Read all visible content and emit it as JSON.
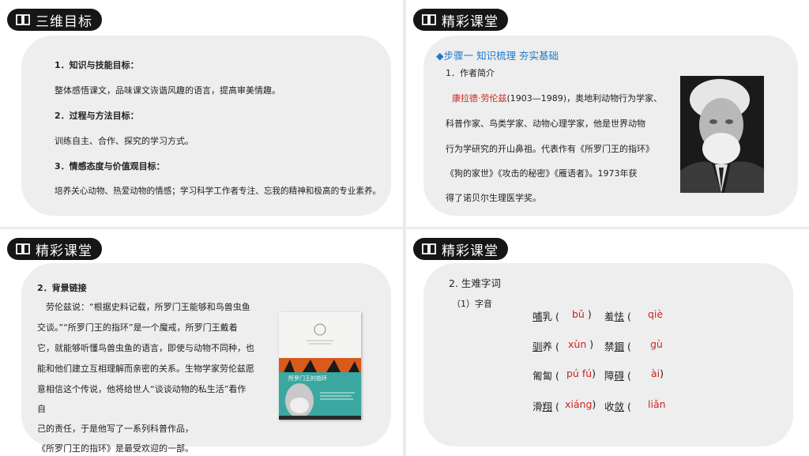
{
  "q1": {
    "header": "三维目标",
    "lines": [
      "1．知识与技能目标：",
      "整体感悟课文，品味课文诙谐风趣的语言，提高审美情趣。",
      "2．过程与方法目标：",
      "训练自主、合作、探究的学习方式。",
      "3．情感态度与价值观目标：",
      "培养关心动物、热爱动物的情感；学习科学工作者专注、忘我的精神和极高的专业素养。"
    ]
  },
  "q2": {
    "header": "精彩课堂",
    "step": "◆步骤一  知识梳理  夯实基础",
    "intro_title": "1．作者简介",
    "author_name": "康拉德·劳伦兹",
    "bio_first_rest": "(1903—1989)，奥地利动物行为学家、",
    "bio_lines": [
      "科普作家、鸟类学家、动物心理学家，他是世界动物",
      "行为学研究的开山鼻祖。代表作有《所罗门王的指环》",
      "《狗的家世》《攻击的秘密》《雁语者》。1973年获",
      "得了诺贝尔生理医学奖。"
    ]
  },
  "q3": {
    "header": "精彩课堂",
    "title": "2．背景链接",
    "lines": [
      "劳伦兹说：“根据史料记载，所罗门王能够和鸟兽虫鱼",
      "交谈。”“所罗门王的指环”是一个魔戒，所罗门王戴着",
      "它，就能够听懂鸟兽虫鱼的语言，即使与动物不同种，也",
      "能和他们建立互相理解而亲密的关系。生物学家劳伦兹愿",
      "意相信这个传说，他将给世人“谈谈动物的私生活”看作",
      "自",
      "己的责任，于是他写了一系列科普作品，",
      "《所罗门王的指环》是最受欢迎的一部。"
    ],
    "book_title": "所罗门王的指环"
  },
  "q4": {
    "header": "精彩课堂",
    "title": "2. 生难字词",
    "subtitle": "（1）字音",
    "words": [
      {
        "a": "哺",
        "b": "乳",
        "pinyin": "bǔ"
      },
      {
        "a": "羞",
        "b": "怯",
        "pinyin": "qiè"
      },
      {
        "a": "驯",
        "b": "养",
        "pinyin": "xùn"
      },
      {
        "a": "禁",
        "b": "錮",
        "pinyin": "gù"
      },
      {
        "a": "匍",
        "b": "匐",
        "pinyin": "pú fú"
      },
      {
        "a": "障",
        "b": "碍",
        "pinyin": "ài"
      },
      {
        "a": "滑",
        "b": "翔",
        "pinyin": "xiáng"
      },
      {
        "a": "收",
        "b": "敛",
        "pinyin": "liǎn"
      }
    ]
  },
  "colors": {
    "accent_blue": "#1f78c8",
    "accent_red": "#cc2222",
    "pill_bg": "#161616"
  }
}
